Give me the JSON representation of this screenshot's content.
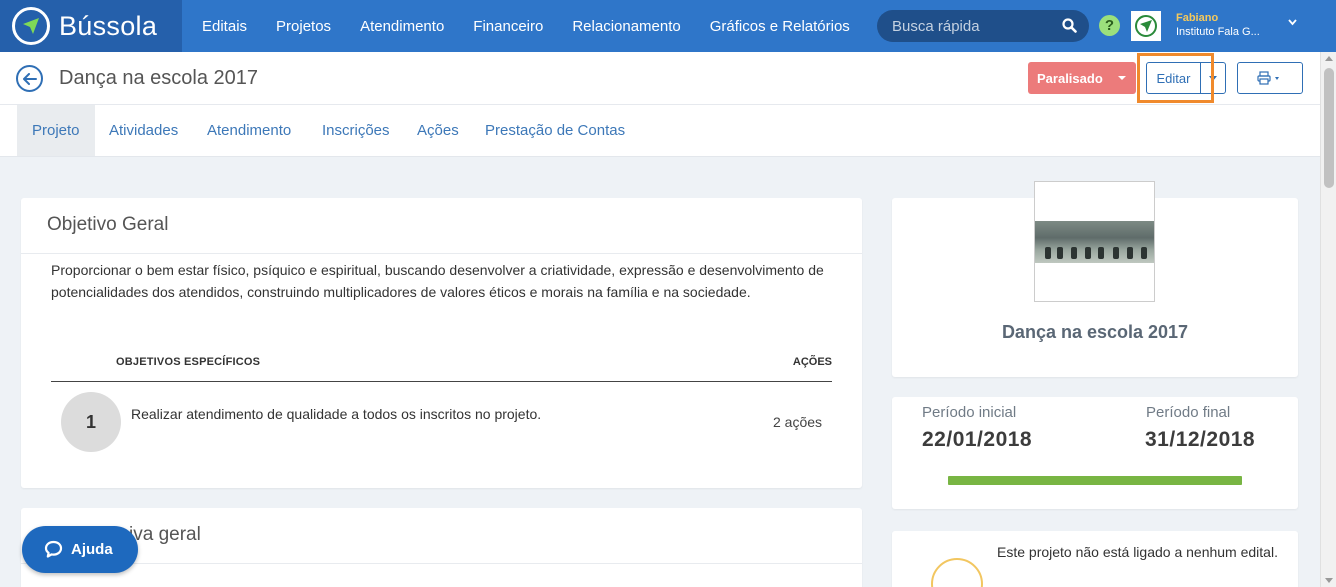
{
  "app": {
    "name": "Bússola"
  },
  "nav": {
    "items": [
      {
        "label": "Editais"
      },
      {
        "label": "Projetos"
      },
      {
        "label": "Atendimento"
      },
      {
        "label": "Financeiro"
      },
      {
        "label": "Relacionamento"
      },
      {
        "label": "Gráficos e Relatórios"
      }
    ],
    "search_placeholder": "Busca rápida"
  },
  "user": {
    "name": "Fabiano",
    "org": "Instituto Fala G..."
  },
  "header": {
    "title": "Dança na escola 2017",
    "status_label": "Paralisado",
    "edit_label": "Editar"
  },
  "tabs": [
    {
      "label": "Projeto",
      "active": true
    },
    {
      "label": "Atividades"
    },
    {
      "label": "Atendimento"
    },
    {
      "label": "Inscrições"
    },
    {
      "label": "Ações"
    },
    {
      "label": "Prestação de Contas"
    }
  ],
  "objetivo": {
    "title": "Objetivo Geral",
    "text": "Proporcionar o bem estar físico, psíquico e espiritual, buscando desenvolver a criatividade, expressão e desenvolvimento de potencialidades dos atendidos, construindo multiplicadores de valores éticos e morais na família e na sociedade.",
    "col_specific": "OBJETIVOS ESPECÍFICOS",
    "col_actions": "AÇÕES",
    "items": [
      {
        "number": "1",
        "text": "Realizar atendimento de qualidade a todos os inscritos no projeto.",
        "actions": "2 ações"
      }
    ]
  },
  "justificativa": {
    "title_visible": "iva geral"
  },
  "project_card": {
    "title": "Dança na escola 2017"
  },
  "periodo": {
    "start_label": "Período inicial",
    "start_date": "22/01/2018",
    "end_label": "Período final",
    "end_date": "31/12/2018",
    "progress_percent": 100,
    "progress_color": "#78b543"
  },
  "edital_card": {
    "text": "Este projeto não está ligado a nenhum edital."
  },
  "help_button": {
    "label": "Ajuda"
  },
  "colors": {
    "navbar": "#2f76c9",
    "logo_bg": "#2560ab",
    "status": "#ec7b7b",
    "accent": "#2f6fb5",
    "highlight": "#f08a2c"
  }
}
